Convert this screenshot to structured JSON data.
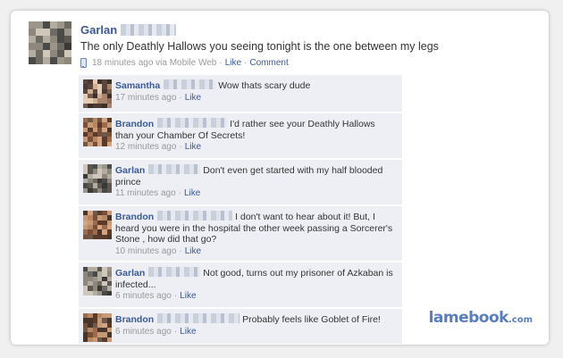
{
  "post": {
    "author": "Garlan",
    "text": "The only Deathly Hallows you seeing tonight is the one between my legs",
    "time": "18 minutes ago via Mobile Web",
    "like_label": "Like",
    "comment_label": "Comment",
    "separator": "·"
  },
  "comments": [
    {
      "author": "Samantha",
      "text": "Wow thats scary dude",
      "time": "17 minutes ago",
      "like_label": "Like"
    },
    {
      "author": "Brandon",
      "text": "I'd rather see your Deathly Hallows than your Chamber Of Secrets!",
      "time": "12 minutes ago",
      "like_label": "Like"
    },
    {
      "author": "Garlan",
      "text": "Don't even get started with my half blooded prince",
      "time": "11 minutes ago",
      "like_label": "Like"
    },
    {
      "author": "Brandon",
      "text": "I don't want to hear about it! But, I heard you were in the hospital the other week passing a Sorcerer's Stone , how did that go?",
      "time": "10 minutes ago",
      "like_label": "Like"
    },
    {
      "author": "Garlan",
      "text": "Not good, turns out my prisoner of Azkaban is infected...",
      "time": "6 minutes ago",
      "like_label": "Like"
    },
    {
      "author": "Brandon",
      "text": "Probably feels like Goblet of Fire!",
      "time": "6 minutes ago",
      "like_label": "Like"
    }
  ],
  "watermark": {
    "name": "lamebook",
    "tld": ".com"
  },
  "colors": {
    "link": "#3b5998",
    "comment_bg": "#edeff4",
    "meta": "#999999",
    "watermark": "#5a7dbf"
  }
}
